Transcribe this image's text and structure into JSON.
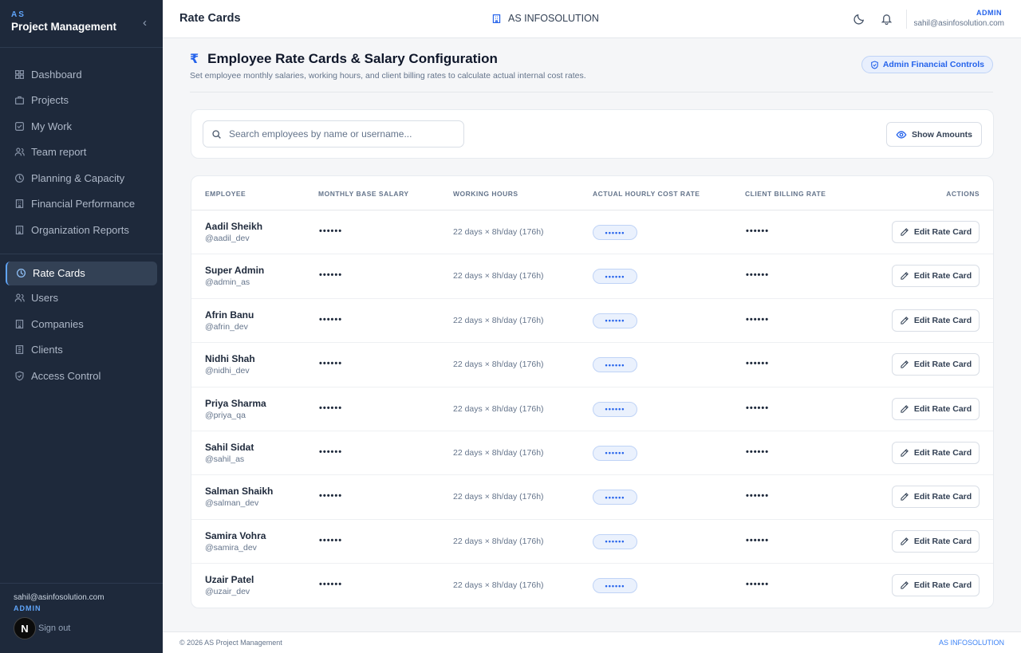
{
  "sidebar": {
    "brand_sub": "AS",
    "brand_title": "Project Management",
    "items": [
      {
        "label": "Dashboard",
        "icon": "grid-icon"
      },
      {
        "label": "Projects",
        "icon": "briefcase-icon"
      },
      {
        "label": "My Work",
        "icon": "check-square-icon"
      },
      {
        "label": "Team report",
        "icon": "users-icon"
      },
      {
        "label": "Planning & Capacity",
        "icon": "clock-icon"
      },
      {
        "label": "Financial Performance",
        "icon": "building-icon"
      },
      {
        "label": "Organization Reports",
        "icon": "building-icon"
      },
      {
        "label": "Rate Cards",
        "icon": "clock-icon",
        "active": true
      },
      {
        "label": "Users",
        "icon": "users-icon"
      },
      {
        "label": "Companies",
        "icon": "building-icon"
      },
      {
        "label": "Clients",
        "icon": "building-icon"
      },
      {
        "label": "Access Control",
        "icon": "shield-icon"
      }
    ],
    "footer": {
      "email": "sahil@asinfosolution.com",
      "role": "ADMIN",
      "badge": "N",
      "signout": "Sign out"
    }
  },
  "header": {
    "title": "Rate Cards",
    "company": "AS INFOSOLUTION",
    "role": "ADMIN",
    "email": "sahil@asinfosolution.com"
  },
  "section": {
    "currency_symbol": "₹",
    "title": "Employee Rate Cards & Salary Configuration",
    "description": "Set employee monthly salaries, working hours, and client billing rates to calculate actual internal cost rates.",
    "admin_badge": "Admin Financial Controls"
  },
  "search": {
    "placeholder": "Search employees by name or username...",
    "show_amounts": "Show Amounts"
  },
  "table": {
    "columns": [
      "EMPLOYEE",
      "MONTHLY BASE SALARY",
      "WORKING HOURS",
      "ACTUAL HOURLY COST RATE",
      "CLIENT BILLING RATE",
      "ACTIONS"
    ],
    "rows": [
      {
        "name": "Aadil Sheikh",
        "username": "@aadil_dev",
        "salary": "••••••",
        "hours": "22 days × 8h/day (176h)",
        "cost_rate": "••••••",
        "billing": "••••••",
        "action": "Edit Rate Card"
      },
      {
        "name": "Super Admin",
        "username": "@admin_as",
        "salary": "••••••",
        "hours": "22 days × 8h/day (176h)",
        "cost_rate": "••••••",
        "billing": "••••••",
        "action": "Edit Rate Card"
      },
      {
        "name": "Afrin Banu",
        "username": "@afrin_dev",
        "salary": "••••••",
        "hours": "22 days × 8h/day (176h)",
        "cost_rate": "••••••",
        "billing": "••••••",
        "action": "Edit Rate Card"
      },
      {
        "name": "Nidhi Shah",
        "username": "@nidhi_dev",
        "salary": "••••••",
        "hours": "22 days × 8h/day (176h)",
        "cost_rate": "••••••",
        "billing": "••••••",
        "action": "Edit Rate Card"
      },
      {
        "name": "Priya Sharma",
        "username": "@priya_qa",
        "salary": "••••••",
        "hours": "22 days × 8h/day (176h)",
        "cost_rate": "••••••",
        "billing": "••••••",
        "action": "Edit Rate Card"
      },
      {
        "name": "Sahil Sidat",
        "username": "@sahil_as",
        "salary": "••••••",
        "hours": "22 days × 8h/day (176h)",
        "cost_rate": "••••••",
        "billing": "••••••",
        "action": "Edit Rate Card"
      },
      {
        "name": "Salman Shaikh",
        "username": "@salman_dev",
        "salary": "••••••",
        "hours": "22 days × 8h/day (176h)",
        "cost_rate": "••••••",
        "billing": "••••••",
        "action": "Edit Rate Card"
      },
      {
        "name": "Samira Vohra",
        "username": "@samira_dev",
        "salary": "••••••",
        "hours": "22 days × 8h/day (176h)",
        "cost_rate": "••••••",
        "billing": "••••••",
        "action": "Edit Rate Card"
      },
      {
        "name": "Uzair Patel",
        "username": "@uzair_dev",
        "salary": "••••••",
        "hours": "22 days × 8h/day (176h)",
        "cost_rate": "••••••",
        "billing": "••••••",
        "action": "Edit Rate Card"
      }
    ]
  },
  "footer": {
    "copyright": "© 2026 AS Project Management",
    "brand": "AS INFOSOLUTION"
  },
  "colors": {
    "sidebar_bg": "#1e293b",
    "accent": "#2563eb",
    "page_bg": "#f5f6f8"
  }
}
